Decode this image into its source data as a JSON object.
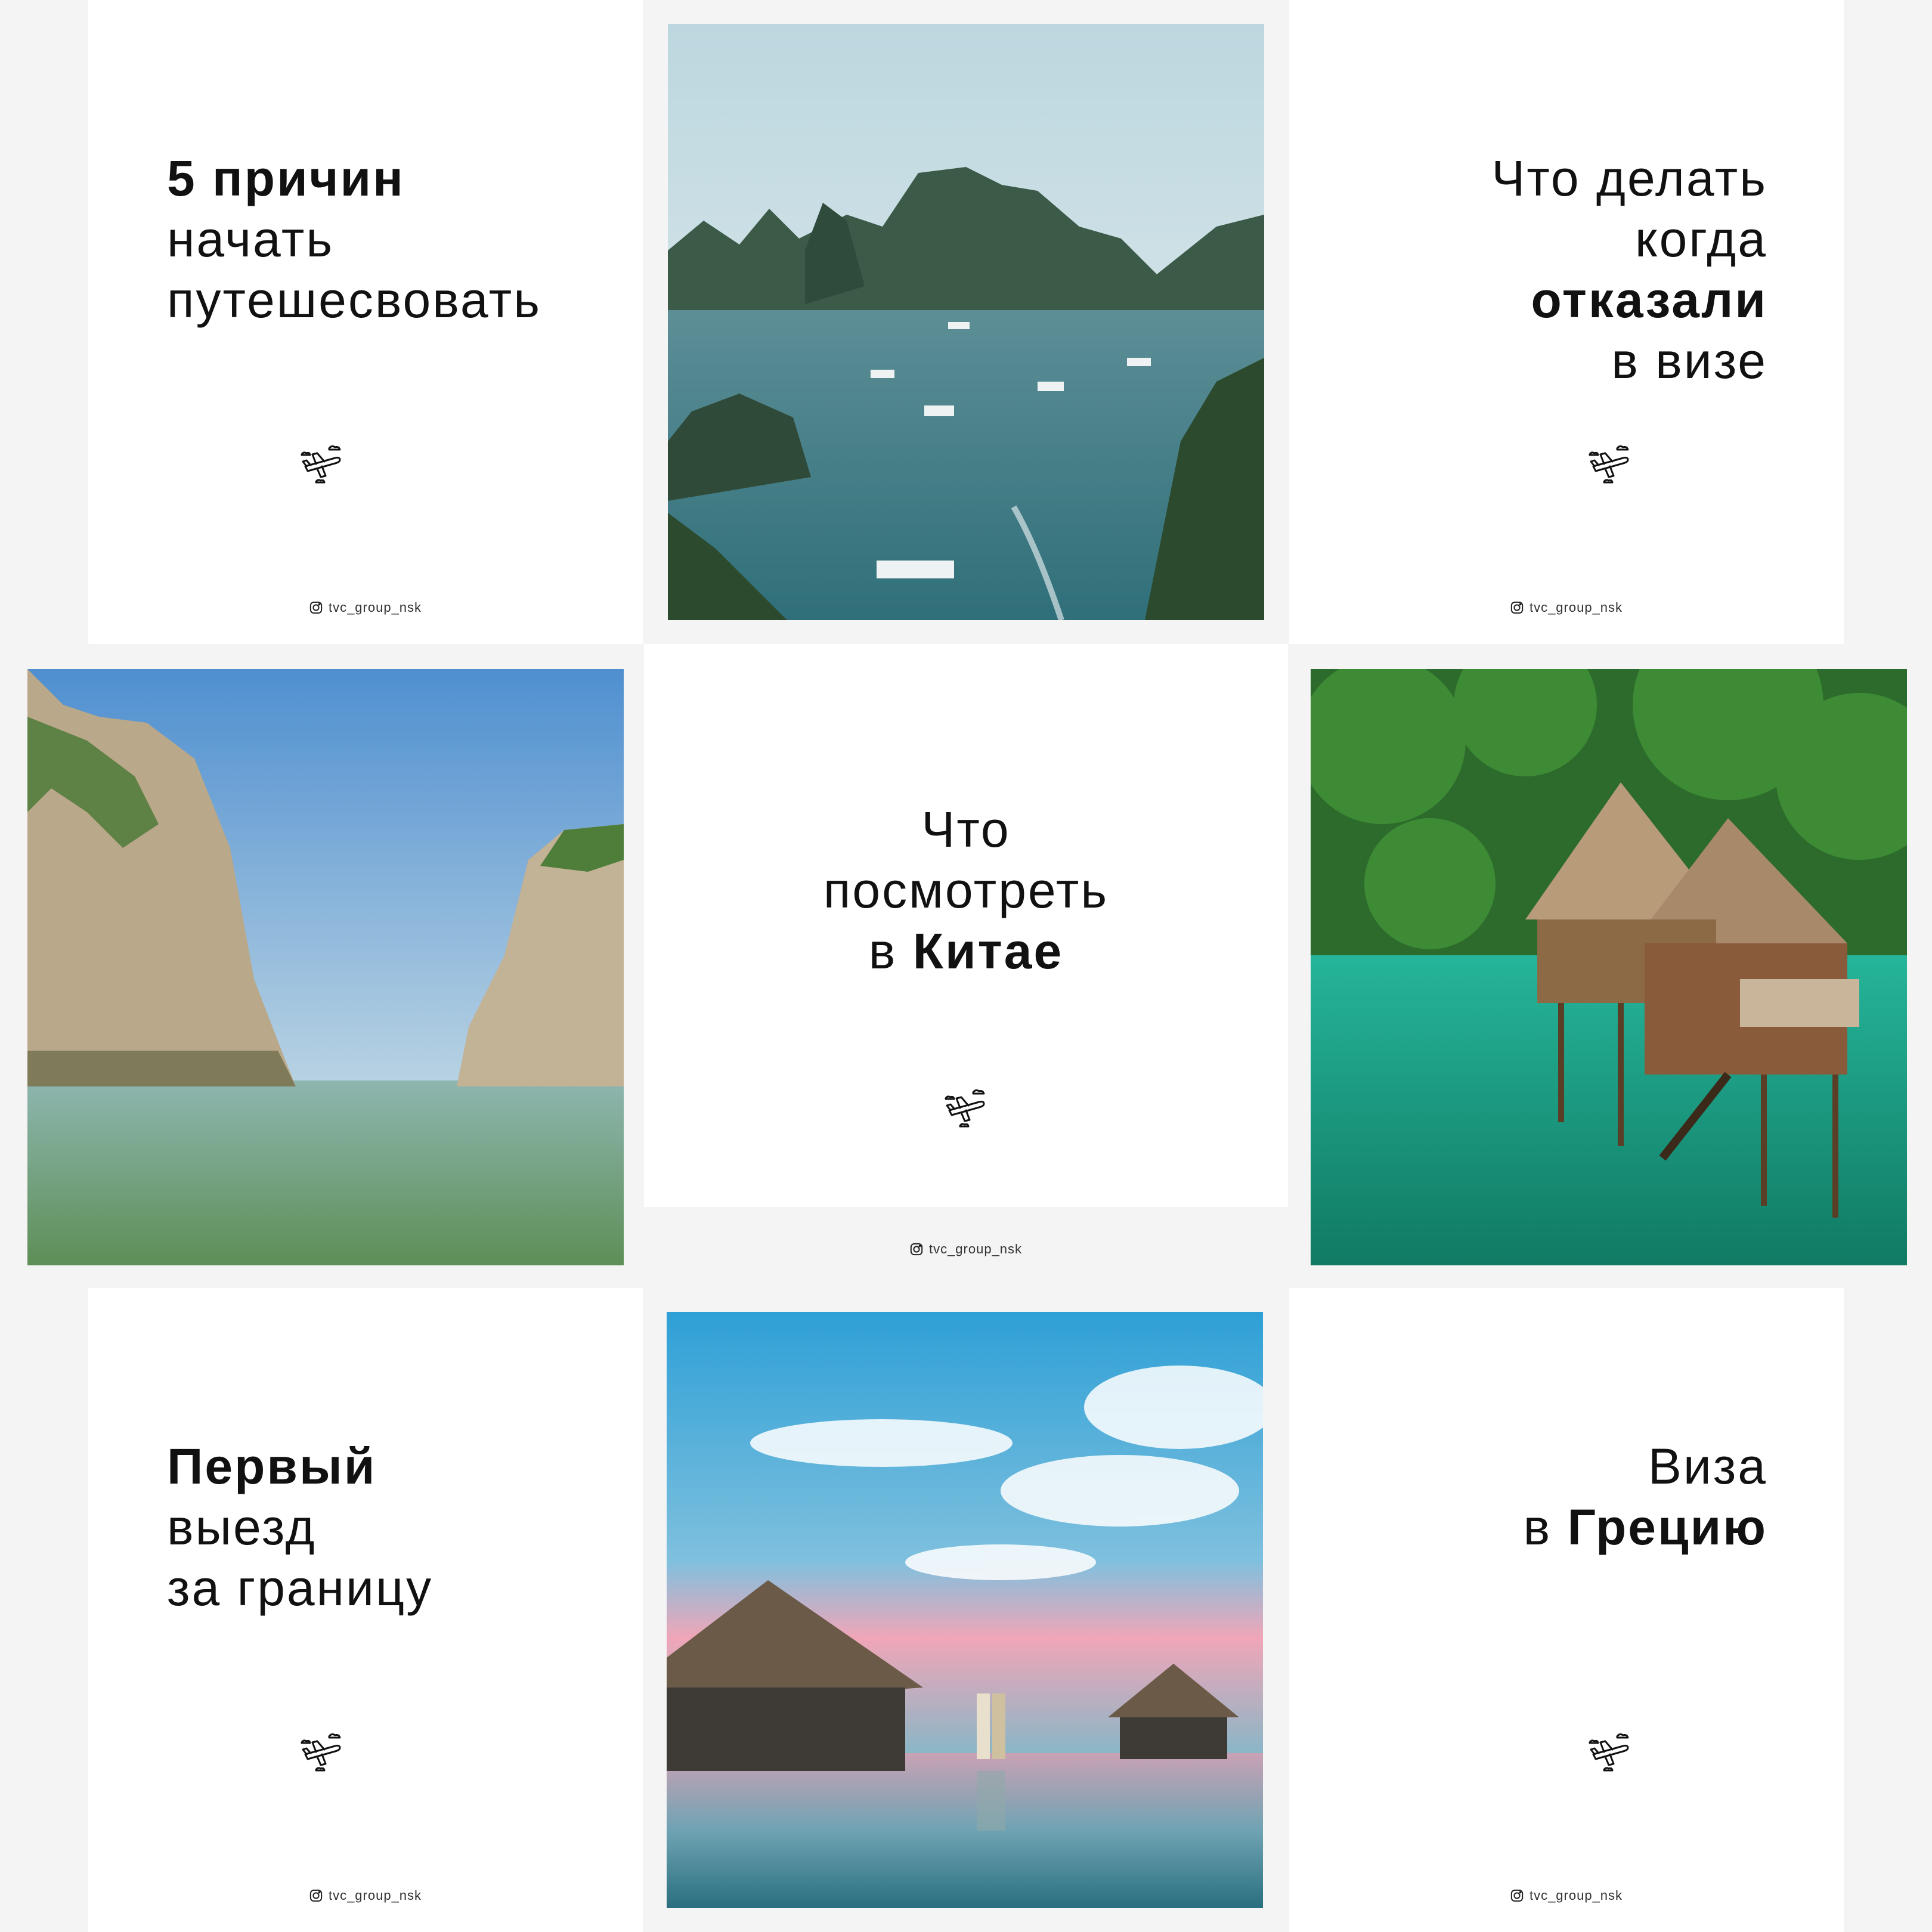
{
  "posts": [
    {
      "id": "reasons",
      "lines": [
        {
          "text": "5 причин",
          "bold": true
        },
        {
          "text": "начать",
          "bold": false
        },
        {
          "text": "путешесвовать",
          "bold": false
        }
      ],
      "handle": "tvc_group_nsk"
    },
    {
      "id": "visa-refused",
      "lines": [
        {
          "text": "Что делать",
          "bold": false
        },
        {
          "text": "когда",
          "bold": false
        },
        {
          "text": "отказали",
          "bold": true
        },
        {
          "text": "в визе",
          "bold": false
        }
      ],
      "handle": "tvc_group_nsk"
    },
    {
      "id": "china",
      "lines": [
        {
          "text": "Что",
          "bold": false
        },
        {
          "text": "посмотреть",
          "bold": false
        }
      ],
      "line3_prefix": "в ",
      "line3_bold": "Китае",
      "handle": "tvc_group_nsk"
    },
    {
      "id": "first-trip",
      "lines": [
        {
          "text": "Первый",
          "bold": true
        },
        {
          "text": "выезд",
          "bold": false
        },
        {
          "text": "за границу",
          "bold": false
        }
      ],
      "handle": "tvc_group_nsk"
    },
    {
      "id": "greece",
      "lines": [
        {
          "text": "Виза",
          "bold": false
        }
      ],
      "line2_prefix": "в ",
      "line2_bold": "Грецию",
      "handle": "tvc_group_nsk"
    }
  ],
  "icons": {
    "travel": "plane-with-clouds-icon",
    "social": "instagram-icon"
  },
  "colors": {
    "background": "#f4f4f4",
    "tile": "#ffffff",
    "text": "#111111",
    "sea_teal": "#3f8d97",
    "lagoon": "#1fa58c",
    "sky_blue": "#4aa4d8"
  }
}
